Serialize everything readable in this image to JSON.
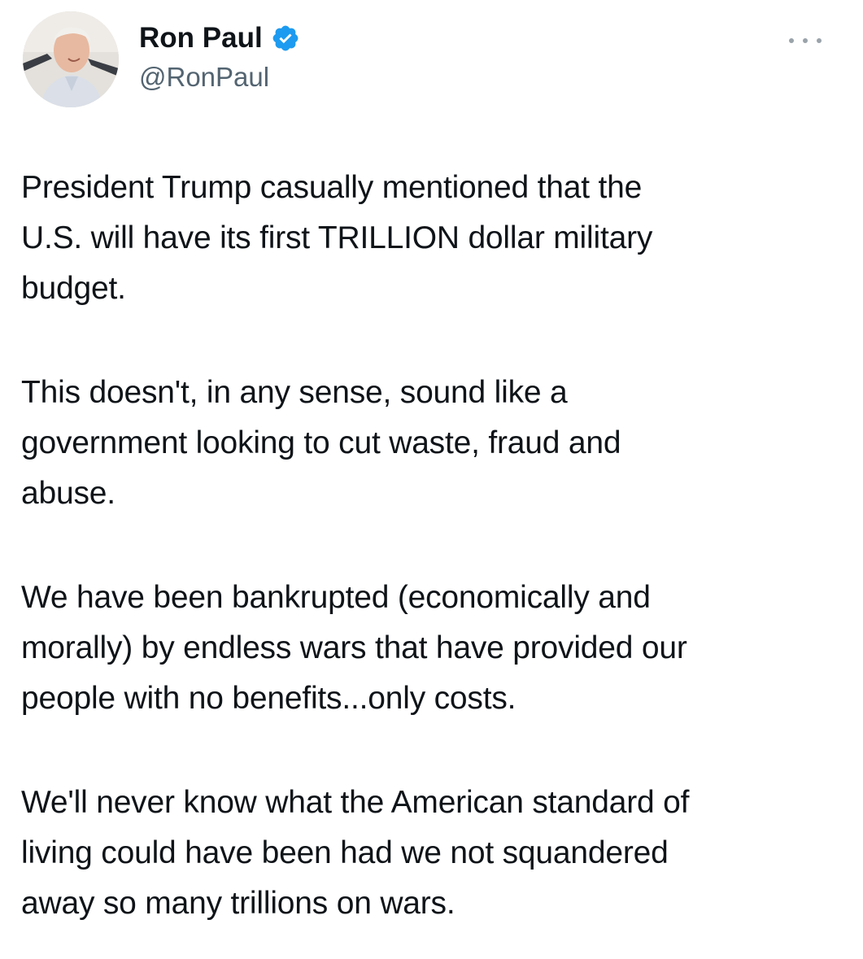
{
  "tweet": {
    "author": {
      "display_name": "Ron Paul",
      "handle": "@RonPaul",
      "verified": true,
      "verified_color": "#1d9bf0",
      "avatar_icon": "profile-photo"
    },
    "more_icon": "more-options-icon",
    "paragraphs": [
      "President Trump casually mentioned that the\nU.S. will have its first TRILLION dollar military\nbudget.",
      "This doesn't, in any sense, sound like a\ngovernment looking to cut waste, fraud and\nabuse.",
      "We have been bankrupted (economically and\nmorally) by endless wars that have provided our\npeople with no benefits...only costs.",
      "We'll never know what the American standard of\nliving could have been had we not squandered\naway so many trillions on wars."
    ]
  },
  "colors": {
    "text": "#0f1419",
    "secondary": "#536471",
    "background": "#ffffff"
  }
}
